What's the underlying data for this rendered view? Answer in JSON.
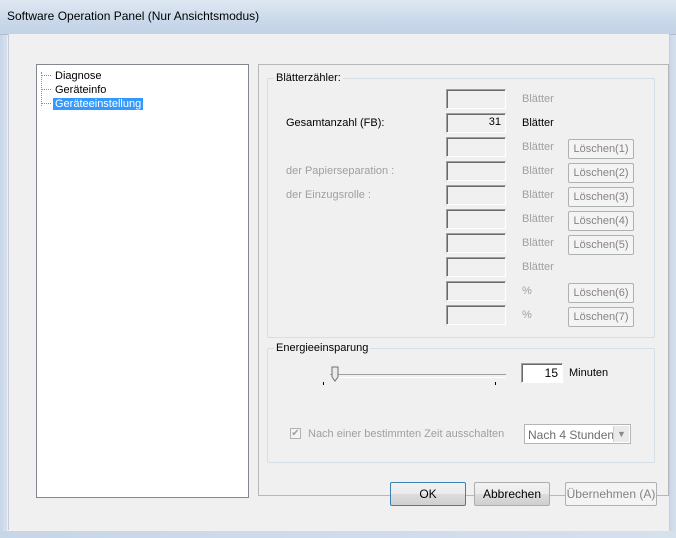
{
  "window": {
    "title": "Software Operation Panel (Nur Ansichtsmodus)"
  },
  "tree": {
    "items": [
      {
        "label": "Diagnose"
      },
      {
        "label": "Geräteinfo"
      },
      {
        "label": "Geräteeinstellung",
        "selected": true
      }
    ]
  },
  "counter": {
    "legend": "Blätterzähler:",
    "rows": [
      {
        "label": "",
        "value": "",
        "unit": "Blätter",
        "button": "",
        "enabled": false
      },
      {
        "label": "Gesamtanzahl (FB):",
        "value": "31",
        "unit": "Blätter",
        "button": "",
        "enabled": true
      },
      {
        "label": "",
        "value": "",
        "unit": "Blätter",
        "button": "Löschen(1)",
        "enabled": false
      },
      {
        "label": "der Papierseparation :",
        "value": "",
        "unit": "Blätter",
        "button": "Löschen(2)",
        "enabled": false
      },
      {
        "label": "der Einzugsrolle :",
        "value": "",
        "unit": "Blätter",
        "button": "Löschen(3)",
        "enabled": false
      },
      {
        "label": "",
        "value": "",
        "unit": "Blätter",
        "button": "Löschen(4)",
        "enabled": false
      },
      {
        "label": "",
        "value": "",
        "unit": "Blätter",
        "button": "Löschen(5)",
        "enabled": false
      },
      {
        "label": "",
        "value": "",
        "unit": "Blätter",
        "button": "",
        "enabled": false
      },
      {
        "label": "",
        "value": "",
        "unit": "%",
        "button": "Löschen(6)",
        "enabled": false
      },
      {
        "label": "",
        "value": "",
        "unit": "%",
        "button": "Löschen(7)",
        "enabled": false
      }
    ]
  },
  "energy": {
    "legend": "Energieeinsparung",
    "minutes_value": "15",
    "minutes_unit": "Minuten",
    "slider_level_fraction": 0.0,
    "checkbox_label": "Nach einer bestimmten Zeit ausschalten",
    "checkbox_checked": true,
    "dropdown_value": "Nach 4 Stunden"
  },
  "buttons": {
    "ok": "OK",
    "cancel": "Abbrechen",
    "apply": "Übernehmen (A)"
  },
  "colors": {
    "selection": "#3399ff",
    "disabled_text": "#a0a0a0"
  }
}
